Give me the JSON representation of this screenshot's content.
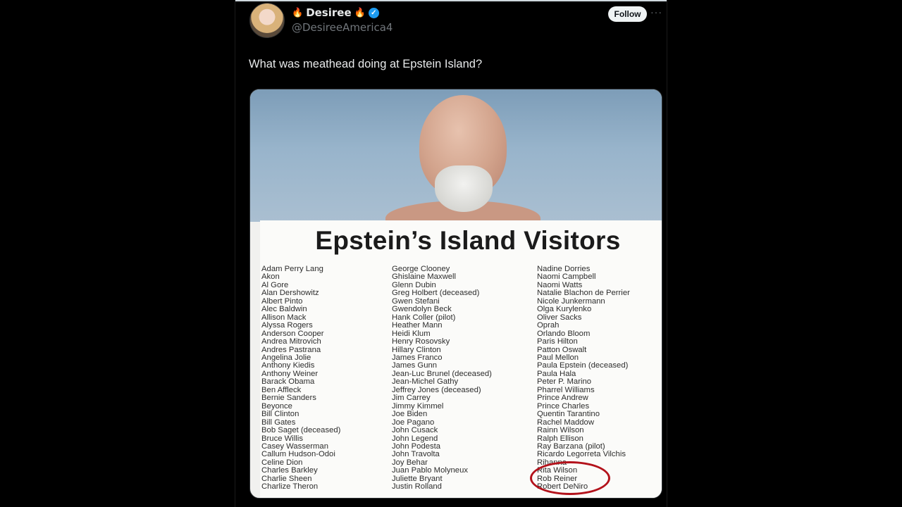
{
  "author": {
    "display_name": "Desiree",
    "fire_emoji": "🔥",
    "verified_mark": "✓",
    "handle": "@DesireeAmerica4"
  },
  "actions": {
    "follow_label": "Follow",
    "more_label": "···"
  },
  "tweet": {
    "text": "What was meathead doing at Epstein Island?"
  },
  "media": {
    "title": "Epstein’s Island Visitors",
    "columns": [
      [
        "Adam Perry Lang",
        "Akon",
        "Al Gore",
        "Alan Dershowitz",
        "Albert Pinto",
        "Alec Baldwin",
        "Allison Mack",
        "Alyssa Rogers",
        "Anderson Cooper",
        "Andrea Mitrovich",
        "Andres Pastrana",
        "Angelina Jolie",
        "Anthony Kiedis",
        "Anthony Weiner",
        "Barack Obama",
        "Ben Affleck",
        "Bernie Sanders",
        "Beyonce",
        "Bill Clinton",
        "Bill Gates",
        "Bob Saget (deceased)",
        "Bruce Willis",
        "Casey Wasserman",
        "Callum Hudson-Odoi",
        "Celine Dion",
        "Charles Barkley",
        "Charlie Sheen",
        "Charlize Theron"
      ],
      [
        "George Clooney",
        "Ghislaine Maxwell",
        "Glenn Dubin",
        "Greg Holbert (deceased)",
        "Gwen Stefani",
        "Gwendolyn Beck",
        "Hank Coller (pilot)",
        "Heather Mann",
        "Heidi Klum",
        "Henry Rosovsky",
        "Hillary Clinton",
        "James Franco",
        "James Gunn",
        "Jean-Luc Brunel (deceased)",
        "Jean-Michel Gathy",
        "Jeffrey Jones (deceased)",
        "Jim Carrey",
        "Jimmy Kimmel",
        "Joe Biden",
        "Joe Pagano",
        "John Cusack",
        "John Legend",
        "John Podesta",
        "John Travolta",
        "Joy Behar",
        "Juan Pablo Molyneux",
        "Juliette Bryant",
        "Justin Rolland"
      ],
      [
        "Nadine Dorries",
        "Naomi Campbell",
        "Naomi Watts",
        "Natalie Blachon de Perrier",
        "Nicole Junkermann",
        "Olga Kurylenko",
        "Oliver Sacks",
        "Oprah",
        "Orlando Bloom",
        "Paris Hilton",
        "Patton Oswalt",
        "Paul Mellon",
        "Paula Epstein (deceased)",
        "Paula Hala",
        "Peter P. Marino",
        "Pharrel Williams",
        "Prince Andrew",
        "Prince Charles",
        "Quentin Tarantino",
        "Rachel Maddow",
        "Rainn Wilson",
        "Ralph Ellison",
        "Ray Barzana (pilot)",
        "Ricardo Legorreta Vilchis",
        "Rihanna",
        "Rita Wilson",
        "Rob Reiner",
        "Robert DeNiro"
      ]
    ],
    "highlight_color": "#b3121b"
  }
}
